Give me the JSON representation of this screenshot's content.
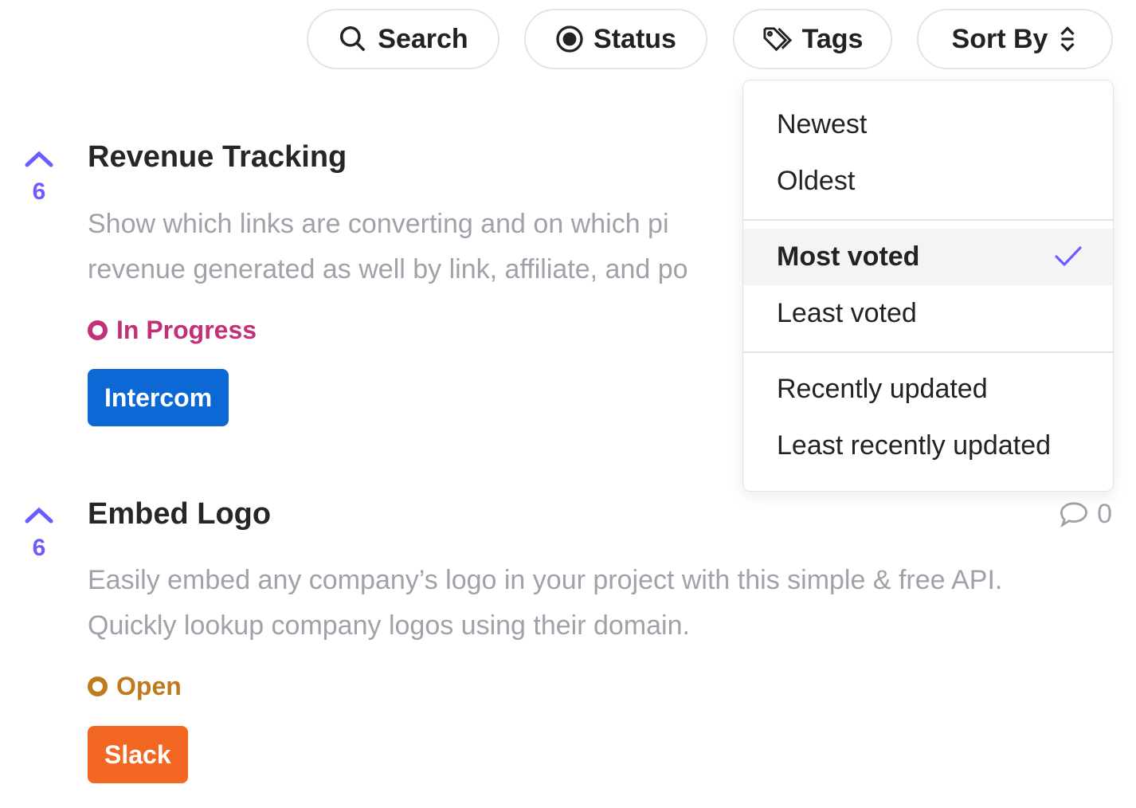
{
  "toolbar": {
    "search_label": "Search",
    "status_label": "Status",
    "tags_label": "Tags",
    "sort_label": "Sort By"
  },
  "sort_menu": {
    "options": [
      "Newest",
      "Oldest",
      "Most voted",
      "Least voted",
      "Recently updated",
      "Least recently updated"
    ],
    "selected": "Most voted"
  },
  "posts": [
    {
      "votes": "6",
      "title": "Revenue Tracking",
      "description_lines": [
        "Show which links are converting and on which pi",
        "revenue generated as well by link, affiliate, and po"
      ],
      "status": "In Progress",
      "status_color": "#c2307a",
      "tag": "Intercom",
      "tag_color": "#0b68d4"
    },
    {
      "votes": "6",
      "title": "Embed Logo",
      "description_lines": [
        "Easily embed any company’s logo in your project with this simple & free API.",
        "Quickly lookup company logos using their domain."
      ],
      "status": "Open",
      "status_color": "#c07a1e",
      "tag": "Slack",
      "tag_color": "#f26722",
      "comments": "0"
    }
  ],
  "colors": {
    "accent": "#6a5cff"
  }
}
